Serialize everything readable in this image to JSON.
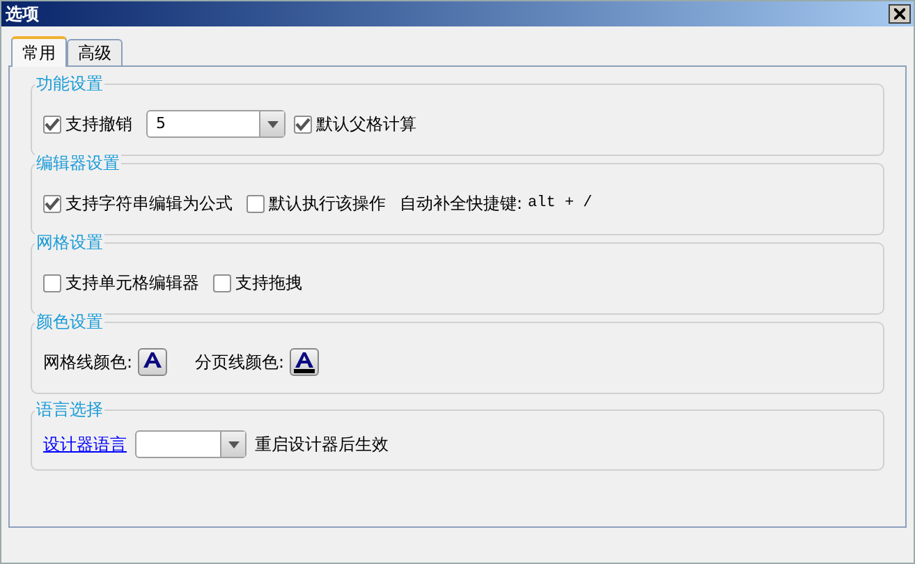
{
  "window": {
    "title": "选项"
  },
  "tabs": [
    {
      "label": "常用",
      "selected": true
    },
    {
      "label": "高级",
      "selected": false
    }
  ],
  "groups": [
    {
      "title": "功能设置",
      "items": [
        {
          "kind": "checkbox",
          "label": "支持撤销",
          "checked": true
        },
        {
          "kind": "select",
          "value": "5",
          "wide": true
        },
        {
          "kind": "checkbox",
          "label": "默认父格计算",
          "checked": true
        }
      ]
    },
    {
      "title": "编辑器设置",
      "items": [
        {
          "kind": "checkbox",
          "label": "支持字符串编辑为公式",
          "checked": true
        },
        {
          "kind": "checkbox",
          "label": "默认执行该操作",
          "checked": false
        },
        {
          "kind": "label",
          "label": "自动补全快捷键:"
        },
        {
          "kind": "shortcut",
          "label": "alt + /"
        }
      ]
    },
    {
      "title": "网格设置",
      "items": [
        {
          "kind": "checkbox",
          "label": "支持单元格编辑器",
          "checked": false
        },
        {
          "kind": "checkbox",
          "label": "支持拖拽",
          "checked": false
        }
      ]
    },
    {
      "title": "颜色设置",
      "items": [
        {
          "kind": "label",
          "label": "网格线颜色:"
        },
        {
          "kind": "color-button",
          "underlined": false
        },
        {
          "kind": "label",
          "label": "分页线颜色:"
        },
        {
          "kind": "color-button",
          "underlined": true
        }
      ]
    },
    {
      "title": "语言选择",
      "items": [
        {
          "kind": "link",
          "label": "设计器语言"
        },
        {
          "kind": "select",
          "wide": false
        },
        {
          "kind": "label",
          "label": "重启设计器后生效"
        }
      ]
    }
  ]
}
